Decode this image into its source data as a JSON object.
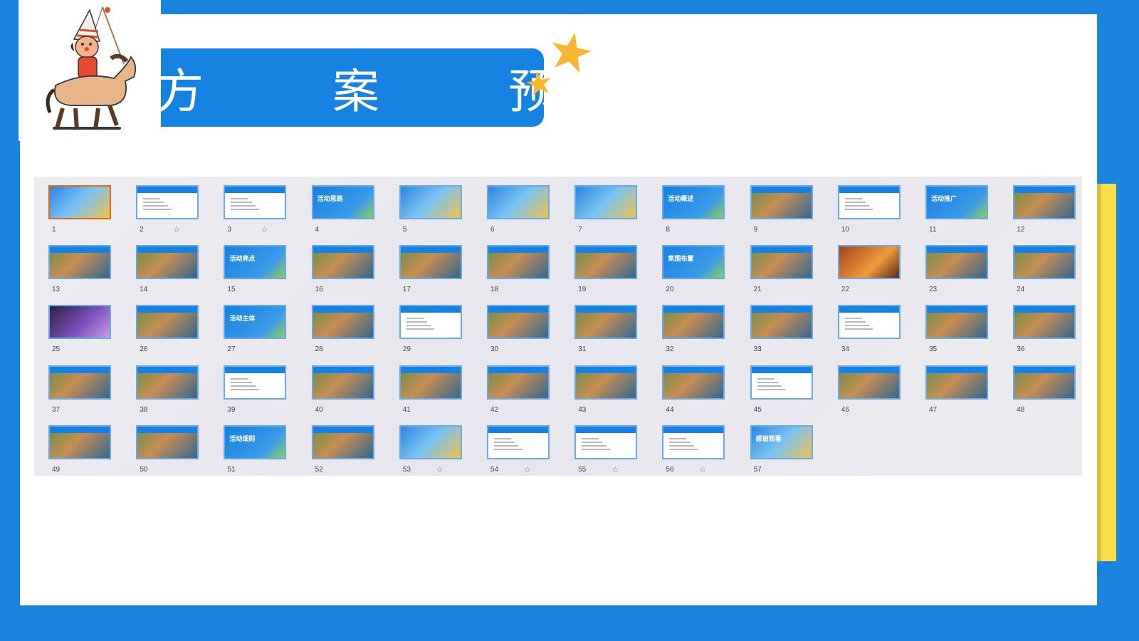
{
  "title": "方 案 预 览",
  "colors": {
    "brand_blue": "#1581e0",
    "background_blue": "#1a83dd",
    "accent_yellow": "#f6dd4a",
    "star_yellow": "#f8b631",
    "selected_border": "#e06b1a"
  },
  "icons": {
    "logo": "puppet-horse-rider-icon",
    "decoration": "star-icon",
    "slide_mark": "star-outline-icon"
  },
  "slides": [
    {
      "n": "1",
      "style": "photo-blue",
      "selected": true
    },
    {
      "n": "2",
      "style": "text",
      "star": true
    },
    {
      "n": "3",
      "style": "text",
      "star": true
    },
    {
      "n": "4",
      "style": "blue-title",
      "label": "活动思路"
    },
    {
      "n": "5",
      "style": "photo-blue"
    },
    {
      "n": "6",
      "style": "photo-blue"
    },
    {
      "n": "7",
      "style": "photo-blue"
    },
    {
      "n": "8",
      "style": "blue-title",
      "label": "活动概述"
    },
    {
      "n": "9",
      "style": "photo"
    },
    {
      "n": "10",
      "style": "text"
    },
    {
      "n": "11",
      "style": "blue-title",
      "label": "活动推广"
    },
    {
      "n": "12",
      "style": "photo"
    },
    {
      "n": "13",
      "style": "photo"
    },
    {
      "n": "14",
      "style": "photo"
    },
    {
      "n": "15",
      "style": "blue-title",
      "label": "活动亮点"
    },
    {
      "n": "16",
      "style": "photo"
    },
    {
      "n": "17",
      "style": "photo"
    },
    {
      "n": "18",
      "style": "photo"
    },
    {
      "n": "19",
      "style": "photo"
    },
    {
      "n": "20",
      "style": "blue-title",
      "label": "氛围布置"
    },
    {
      "n": "21",
      "style": "photo"
    },
    {
      "n": "22",
      "style": "photo-orange"
    },
    {
      "n": "23",
      "style": "photo"
    },
    {
      "n": "24",
      "style": "photo"
    },
    {
      "n": "25",
      "style": "photo-purple"
    },
    {
      "n": "26",
      "style": "photo"
    },
    {
      "n": "27",
      "style": "blue-title",
      "label": "活动主体"
    },
    {
      "n": "28",
      "style": "photo"
    },
    {
      "n": "29",
      "style": "text"
    },
    {
      "n": "30",
      "style": "photo"
    },
    {
      "n": "31",
      "style": "photo"
    },
    {
      "n": "32",
      "style": "photo"
    },
    {
      "n": "33",
      "style": "photo"
    },
    {
      "n": "34",
      "style": "text"
    },
    {
      "n": "35",
      "style": "photo"
    },
    {
      "n": "36",
      "style": "photo"
    },
    {
      "n": "37",
      "style": "photo"
    },
    {
      "n": "38",
      "style": "photo"
    },
    {
      "n": "39",
      "style": "text"
    },
    {
      "n": "40",
      "style": "photo"
    },
    {
      "n": "41",
      "style": "photo"
    },
    {
      "n": "42",
      "style": "photo"
    },
    {
      "n": "43",
      "style": "photo"
    },
    {
      "n": "44",
      "style": "photo"
    },
    {
      "n": "45",
      "style": "text"
    },
    {
      "n": "46",
      "style": "photo"
    },
    {
      "n": "47",
      "style": "photo"
    },
    {
      "n": "48",
      "style": "photo"
    },
    {
      "n": "49",
      "style": "photo"
    },
    {
      "n": "50",
      "style": "photo"
    },
    {
      "n": "51",
      "style": "blue-title",
      "label": "活动细则"
    },
    {
      "n": "52",
      "style": "photo"
    },
    {
      "n": "53",
      "style": "photo-blue",
      "star": true
    },
    {
      "n": "54",
      "style": "text",
      "star": true
    },
    {
      "n": "55",
      "style": "text",
      "star": true
    },
    {
      "n": "56",
      "style": "text",
      "star": true
    },
    {
      "n": "57",
      "style": "photo-blue",
      "label": "感谢观看"
    }
  ]
}
